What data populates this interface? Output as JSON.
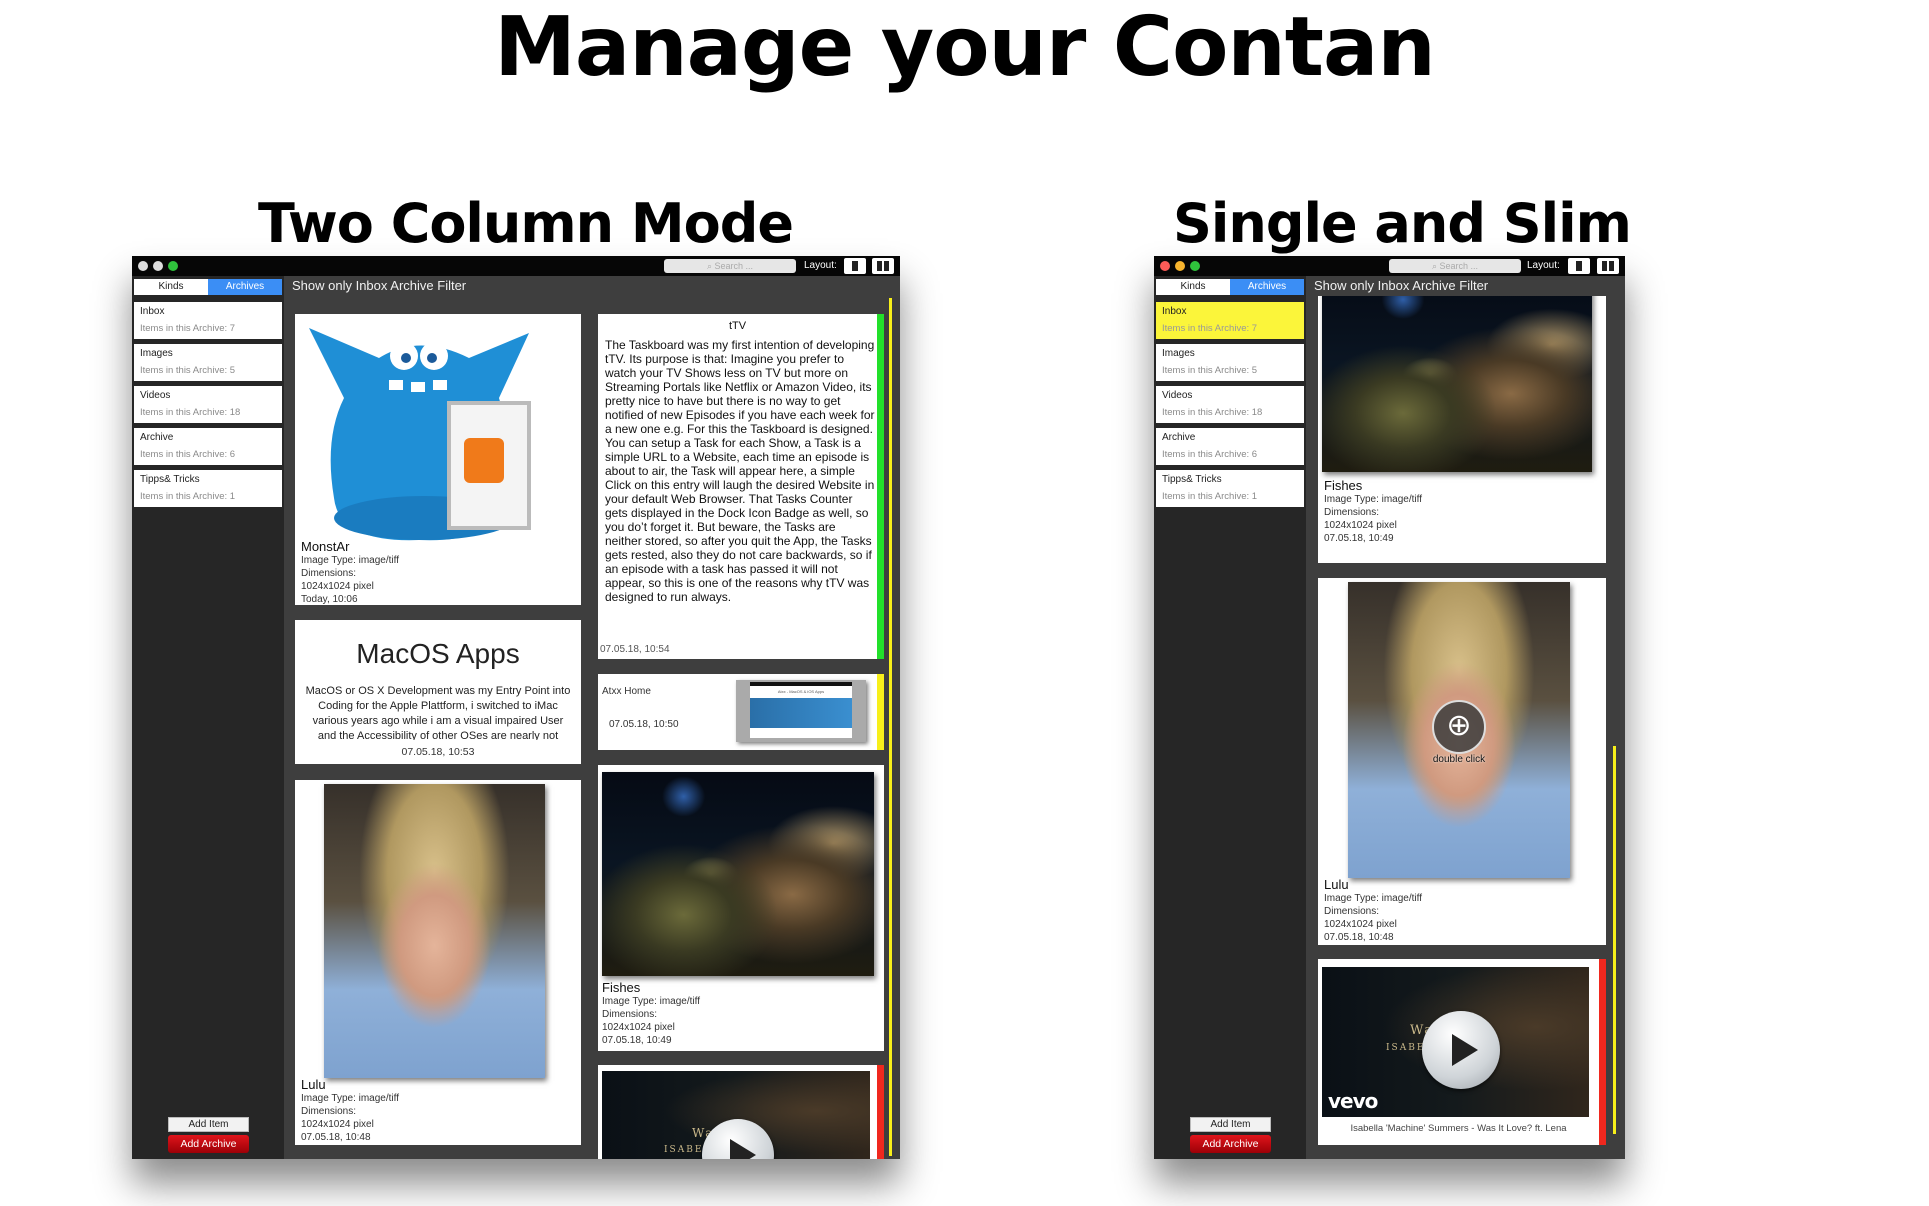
{
  "headline": "Manage your Contan",
  "left_caption": "Two Column Mode",
  "right_caption": "Single and Slim",
  "window": {
    "search_placeholder": "Search ...",
    "layout_label": "Layout:",
    "tabs": {
      "kinds": "Kinds",
      "archives": "Archives"
    },
    "filter_label": "Show only Inbox Archive Filter",
    "archives": [
      {
        "name": "Inbox",
        "count": "Items in this Archive: 7"
      },
      {
        "name": "Images",
        "count": "Items in this Archive: 5"
      },
      {
        "name": "Videos",
        "count": "Items in this Archive: 18"
      },
      {
        "name": "Archive",
        "count": "Items in this Archive: 6"
      },
      {
        "name": "Tipps& Tricks",
        "count": "Items in this Archive: 1"
      }
    ],
    "add_item": "Add Item",
    "add_archive": "Add Archive"
  },
  "cards": {
    "monstar": {
      "title": "MonstAr",
      "type": "Image Type: image/tiff",
      "dim_label": "Dimensions:",
      "dim": "1024x1024 pixel",
      "date": "Today, 10:06"
    },
    "macos": {
      "title": "MacOS Apps",
      "body": "MacOS or OS X Development was my Entry Point into Coding for the Apple Plattform, i switched to iMac various years ago while i am a visual impaired User and the Accessibility of other OSes are nearly not present or",
      "date": "07.05.18, 10:53"
    },
    "lulu": {
      "title": "Lulu",
      "type": "Image Type: image/tiff",
      "dim_label": "Dimensions:",
      "dim": "1024x1024 pixel",
      "date": "07.05.18, 10:48"
    },
    "ttv": {
      "title": "tTV",
      "body": "The Taskboard was my first intention of developing tTV. Its purpose is that: Imagine you prefer to watch your TV Shows less on TV but more on Streaming Portals like Netflix or Amazon Video, its pretty nice to have but there is no way to get notified of new Episodes if you have each week for a new one e.g. For this the Taskboard is designed. You can setup a Task for each Show, a Task is a simple URL to a Website, each time an episode is about to air, the Task will appear here, a simple Click on this entry will laugh the desired Website in your default Web Browser. That Tasks Counter gets displayed in the Dock Icon Badge as well, so you do’t forget it. But beware, the Tasks are neither stored, so after you quit the App, the Tasks gets rested, also they do not care backwards, so if an episode with a task has passed it will not appear, so this is one of the reasons why tTV was designed to run always.",
      "date": "07.05.18, 10:54"
    },
    "atxx": {
      "title": "Atxx Home",
      "date": "07.05.18, 10:50",
      "thumb_title": "Atxx - MacOS & iOS Apps"
    },
    "fishes": {
      "title": "Fishes",
      "type": "Image Type: image/tiff",
      "dim_label": "Dimensions:",
      "dim": "1024x1024 pixel",
      "date": "07.05.18, 10:49"
    },
    "video": {
      "caption": "Isabella 'Machine' Summers - Was It Love? ft. Lena",
      "logo": "vevo",
      "overlay_line1": "Wa",
      "overlay_line2": "ISABELL          MERS"
    }
  },
  "zoom_hint": "double click",
  "colors": {
    "green_marker": "#22e02a",
    "yellow_marker": "#f7ef1a",
    "red_marker": "#f0281e",
    "accent": "#3b8ef5",
    "selected": "#fbf53a"
  }
}
